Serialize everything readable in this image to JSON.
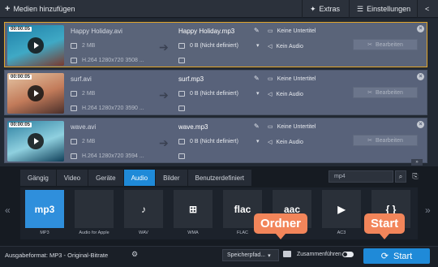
{
  "toolbar": {
    "add_media": "Medien hinzufügen",
    "extras": "Extras",
    "settings": "Einstellungen"
  },
  "files": [
    {
      "timestamp": "00:00:05",
      "source_name": "Happy Holiday.avi",
      "source_size": "2 MB",
      "source_info": "H.264 1280x720 3508 ...",
      "output_name": "Happy Holiday.mp3",
      "output_size": "0 B (Nicht definiert)",
      "subtitle": "Keine Untertitel",
      "audio": "Kein Audio",
      "edit": "Bearbeiten",
      "selected": true,
      "thumb_colors": [
        "#1f7fa8",
        "#3fa9c5",
        "#7a3a2e"
      ]
    },
    {
      "timestamp": "00:00:05",
      "source_name": "surf.avi",
      "source_size": "2 MB",
      "source_info": "H.264 1280x720 3590 ...",
      "output_name": "surf.mp3",
      "output_size": "0 B (Nicht definiert)",
      "subtitle": "Keine Untertitel",
      "audio": "Kein Audio",
      "edit": "Bearbeiten",
      "selected": false,
      "thumb_colors": [
        "#e5c6a5",
        "#c27b5a",
        "#4a2f2a"
      ]
    },
    {
      "timestamp": "00:00:05",
      "source_name": "wave.avi",
      "source_size": "2 MB",
      "source_info": "H.264 1280x720 3594 ...",
      "output_name": "wave.mp3",
      "output_size": "0 B (Nicht definiert)",
      "subtitle": "Keine Untertitel",
      "audio": "Kein Audio",
      "edit": "Bearbeiten",
      "selected": false,
      "thumb_colors": [
        "#2c7fa0",
        "#8fd0df",
        "#0f3f59"
      ]
    }
  ],
  "format_tabs": [
    "Gängig",
    "Video",
    "Geräte",
    "Audio",
    "Bilder",
    "Benutzerdefiniert"
  ],
  "active_tab": "Audio",
  "search": {
    "value": "mp4"
  },
  "formats": [
    {
      "label": "MP3",
      "glyph": "mp3",
      "active": true
    },
    {
      "label": "Audio for Apple",
      "glyph": "",
      "active": false
    },
    {
      "label": "WAV",
      "glyph": "♪",
      "active": false
    },
    {
      "label": "WMA",
      "glyph": "⊞",
      "active": false
    },
    {
      "label": "FLAC",
      "glyph": "flac",
      "active": false
    },
    {
      "label": "AAC",
      "glyph": "aac",
      "active": false
    },
    {
      "label": "AC3",
      "glyph": "▶",
      "active": false
    },
    {
      "label": "",
      "glyph": "{ }",
      "active": false
    }
  ],
  "callouts": {
    "folder": "Ordner",
    "start": "Start"
  },
  "bottom": {
    "output_format": "Ausgabeformat: MP3 - Original-Bitrate",
    "save_path": "Speicherpfad...",
    "merge": "Zusammenführen",
    "start": "Start"
  },
  "colors": {
    "accent": "#1f8ad8",
    "selected_border": "#e0a42a",
    "callout": "#f2855a"
  }
}
